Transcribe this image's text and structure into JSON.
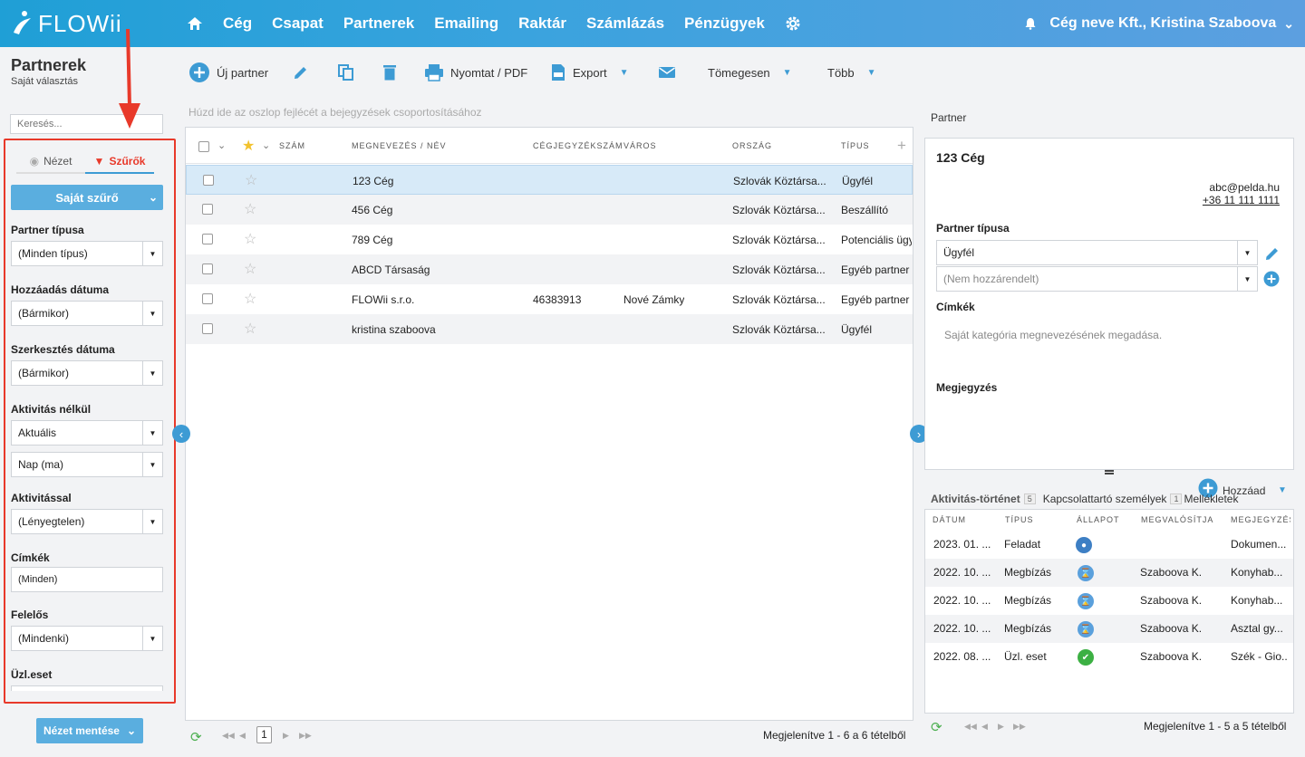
{
  "app": {
    "logo_text": "FLOWii"
  },
  "nav": {
    "items": [
      "Cég",
      "Csapat",
      "Partnerek",
      "Emailing",
      "Raktár",
      "Számlázás",
      "Pénzügyek"
    ]
  },
  "account": {
    "label": "Cég neve Kft., Kristina Szaboova"
  },
  "page": {
    "title": "Partnerek",
    "subtitle": "Saját választás"
  },
  "toolbar": {
    "new_partner": "Új partner",
    "print": "Nyomtat / PDF",
    "export": "Export",
    "bulk": "Tömegesen",
    "more": "Több"
  },
  "sidebar": {
    "search_placeholder": "Keresés...",
    "tab_view": "Nézet",
    "tab_filters": "Szűrők",
    "own_filter": "Saját szűrő",
    "filters": [
      {
        "label": "Partner típusa",
        "values": [
          "(Minden típus)"
        ]
      },
      {
        "label": "Hozzáadás dátuma",
        "values": [
          "(Bármikor)"
        ]
      },
      {
        "label": "Szerkesztés dátuma",
        "values": [
          "(Bármikor)"
        ]
      },
      {
        "label": "Aktivitás nélkül",
        "values": [
          "Aktuális",
          "Nap (ma)"
        ]
      },
      {
        "label": "Aktivitással",
        "values": [
          "(Lényegtelen)"
        ]
      },
      {
        "label": "Címkék",
        "values": [
          "(Minden)"
        ]
      },
      {
        "label": "Felelős",
        "values": [
          "(Mindenki)"
        ]
      },
      {
        "label": "Üzl.eset",
        "values": []
      }
    ],
    "save_view": "Nézet mentése"
  },
  "grid": {
    "group_hint": "Húzd ide az oszlop fejlécét a bejegyzések csoportosításához",
    "columns": [
      "Szám",
      "Megnevezés / Név",
      "Cégjegyzékszám",
      "Város",
      "Ország",
      "Típus"
    ],
    "rows": [
      {
        "name": "123 Cég",
        "reg": "",
        "city": "",
        "country": "Szlovák Köztársa...",
        "type": "Ügyfél"
      },
      {
        "name": "456 Cég",
        "reg": "",
        "city": "",
        "country": "Szlovák Köztársa...",
        "type": "Beszállító"
      },
      {
        "name": "789 Cég",
        "reg": "",
        "city": "",
        "country": "Szlovák Köztársa...",
        "type": "Potenciális ügy"
      },
      {
        "name": "ABCD Társaság",
        "reg": "",
        "city": "",
        "country": "Szlovák Köztársa...",
        "type": "Egyéb partner"
      },
      {
        "name": "FLOWii s.r.o.",
        "reg": "46383913",
        "city": "Nové Zámky",
        "country": "Szlovák Köztársa...",
        "type": "Egyéb partner"
      },
      {
        "name": "kristina szaboova",
        "reg": "",
        "city": "",
        "country": "Szlovák Köztársa...",
        "type": "Ügyfél"
      }
    ],
    "page": "1",
    "summary": "Megjelenítve 1 - 6 a 6 tételből"
  },
  "detail": {
    "section_title": "Partner",
    "name": "123 Cég",
    "email": "abc@pelda.hu",
    "phone": "+36 11 111 1111",
    "partner_type_label": "Partner típusa",
    "partner_type_value": "Ügyfél",
    "partner_type_second": "(Nem hozzárendelt)",
    "tags_label": "Címkék",
    "tags_placeholder": "Saját kategória megnevezésének megadása.",
    "note_label": "Megjegyzés"
  },
  "activity": {
    "add_label": "Hozzáad",
    "tabs": [
      {
        "label": "Aktivitás-történet",
        "count": "5"
      },
      {
        "label": "Kapcsolattartó személyek",
        "count": "1"
      },
      {
        "label": "Mellékletek",
        "count": ""
      }
    ],
    "columns": [
      "Dátum",
      "Típus",
      "Állapot",
      "Megvalósítja",
      "Megjegyzés"
    ],
    "rows": [
      {
        "date": "2023. 01. ...",
        "type": "Feladat",
        "status": "open",
        "owner": "",
        "note": "Dokumen..."
      },
      {
        "date": "2022. 10. ...",
        "type": "Megbízás",
        "status": "waiting",
        "owner": "Szaboova K.",
        "note": "Konyhab..."
      },
      {
        "date": "2022. 10. ...",
        "type": "Megbízás",
        "status": "waiting",
        "owner": "Szaboova K.",
        "note": "Konyhab..."
      },
      {
        "date": "2022. 10. ...",
        "type": "Megbízás",
        "status": "waiting",
        "owner": "Szaboova K.",
        "note": "Asztal gy..."
      },
      {
        "date": "2022. 08. ...",
        "type": "Üzl. eset",
        "status": "done",
        "owner": "Szaboova K.",
        "note": "Szék - Gio..."
      }
    ],
    "summary": "Megjelenítve 1 - 5 a 5 tételből"
  },
  "colors": {
    "accent": "#3d9bd4",
    "highlight_border": "#e8392a",
    "selected_row": "#d7eaf8",
    "alt_row": "#f2f3f5"
  }
}
